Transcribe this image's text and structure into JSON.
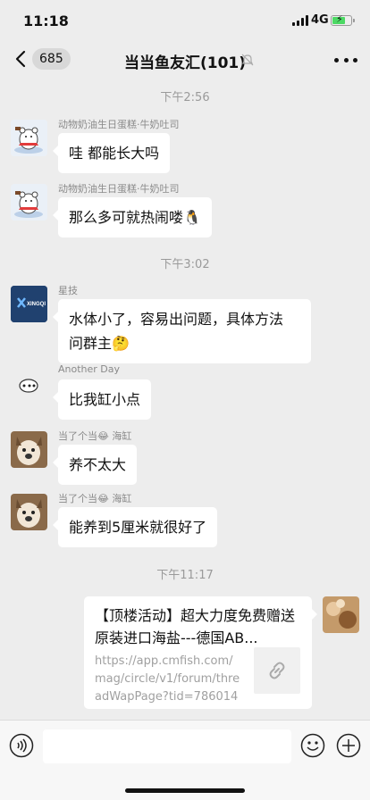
{
  "status": {
    "time": "11:18",
    "network": "4G"
  },
  "nav": {
    "back_count": "685",
    "title": "当当鱼友汇(101)"
  },
  "messages": [
    {
      "time": "下午2:56"
    },
    {
      "sender": "动物奶油生日蛋糕·牛奶吐司",
      "text": "哇 都能长大吗"
    },
    {
      "sender": "动物奶油生日蛋糕·牛奶吐司",
      "text": "那么多可就热闹喽🐧"
    },
    {
      "time": "下午3:02"
    },
    {
      "sender": "星技",
      "text_lines": [
        "水体小了，容易出问题，具体方法",
        "问群主🤔"
      ],
      "avatar_text": "XINGQI"
    },
    {
      "sender": "Another  Day",
      "text": "比我缸小点"
    },
    {
      "sender": "当了个当😂 海缸",
      "text": "养不太大"
    },
    {
      "sender": "当了个当😂 海缸",
      "text": "能养到5厘米就很好了"
    },
    {
      "time": "下午11:17"
    }
  ],
  "link_card": {
    "title": "【顶楼活动】超大力度免费赠送原装进口海盐---德国AB...",
    "url": "https://app.cmfish.com/mag/circle/v1/forum/threadWapPage?tid=786014&..."
  },
  "input": {
    "placeholder": ""
  },
  "icons": [
    "back-icon",
    "mute-icon",
    "more-icon",
    "voice-icon",
    "emoji-icon",
    "plus-icon",
    "link-icon"
  ]
}
